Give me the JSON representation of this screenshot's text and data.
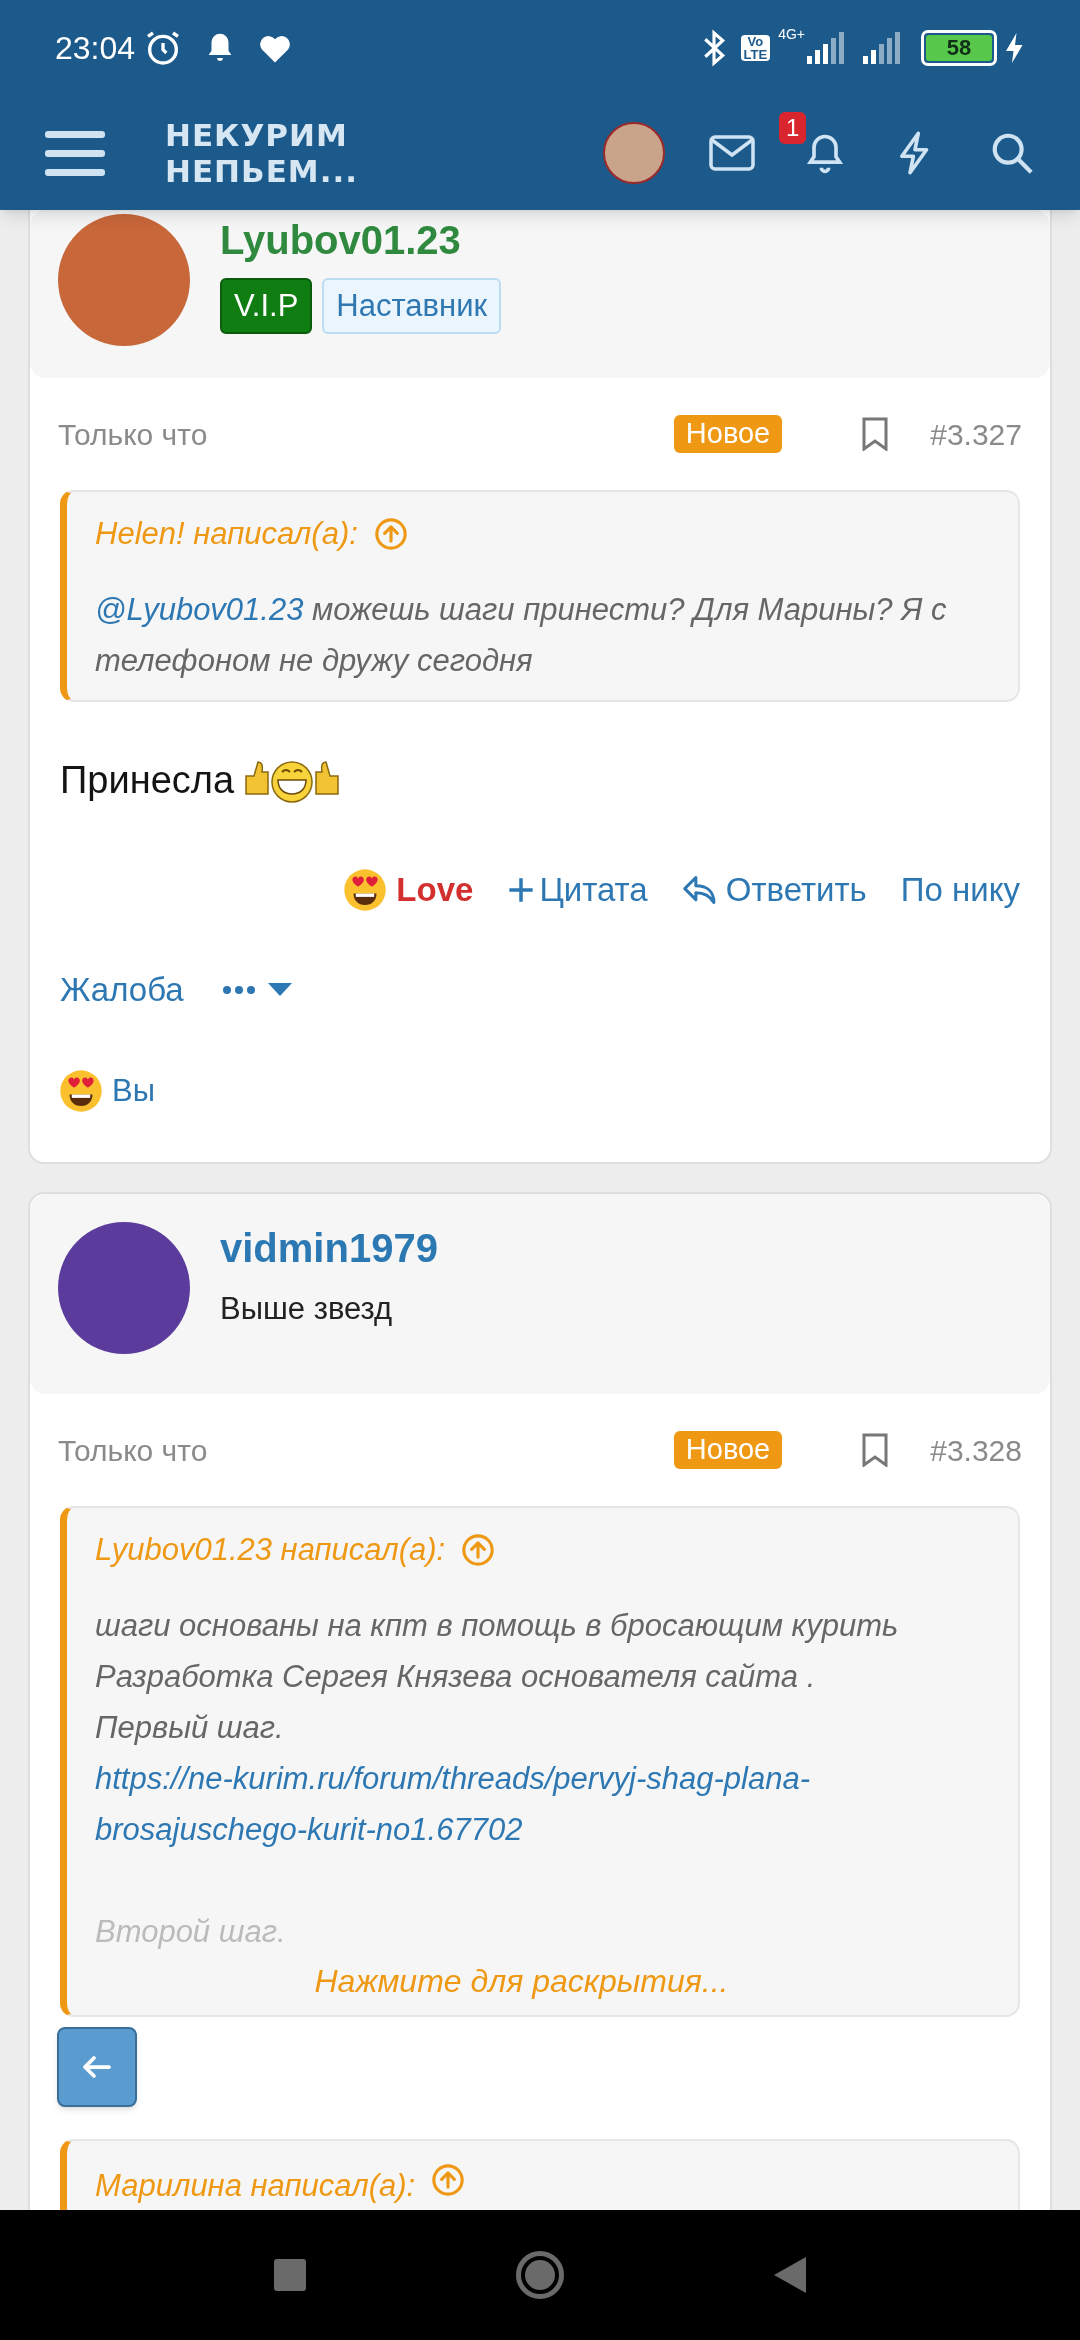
{
  "status_bar": {
    "time": "23:04",
    "volte": [
      "Vo",
      "LTE"
    ],
    "network": "4G+",
    "battery": "58"
  },
  "header": {
    "logo": [
      "НЕКУРИМ",
      "НЕПЬЕМ..."
    ],
    "notification_count": "1"
  },
  "posts": [
    {
      "author": "Lyubov01.23",
      "color": "#2f8a3f",
      "badges": [
        {
          "label": "V.I.P",
          "kind": "vip"
        },
        {
          "label": "Наставник",
          "kind": "mentor"
        }
      ],
      "time": "Только что",
      "new_label": "Новое",
      "number": "#3.327",
      "quote": {
        "author_line": "Helen! написал(а):",
        "paragraphs": [
          {
            "kind": "mention",
            "mention": "@Lyubov01.23",
            "text": " можешь шаги принести? Для Марины? Я с телефоном не дружу сегодня"
          }
        ]
      },
      "body": "Принесла",
      "actions": [
        {
          "kind": "reaction",
          "label": "Love"
        },
        {
          "kind": "quote",
          "label": "Цитата"
        },
        {
          "kind": "reply",
          "label": "Ответить"
        },
        {
          "kind": "plain",
          "label": "По нику"
        }
      ],
      "actions_extra": [
        {
          "kind": "plain",
          "label": "Жалоба"
        },
        {
          "kind": "more"
        }
      ],
      "reaction_summary": "Вы"
    },
    {
      "author": "vidmin1979",
      "color": "#2b78b3",
      "user_title": "Выше звезд",
      "time": "Только что",
      "new_label": "Новое",
      "number": "#3.328",
      "quote": {
        "author_line": "Lyubov01.23 написал(а):",
        "paragraphs": [
          {
            "kind": "text",
            "text": "шаги основаны на кпт в помощь в бросающим курить Разработка Сергея Князева основателя сайта ."
          },
          {
            "kind": "text",
            "text": "Первый шаг."
          },
          {
            "kind": "link",
            "text": "https://ne-kurim.ru/forum/threads/pervyj-shag-plana-brosajuschego-kurit-no1.67702"
          },
          {
            "kind": "gap"
          },
          {
            "kind": "faded",
            "text": "Второй шаг."
          }
        ],
        "expand": "Нажмите для раскрытия..."
      },
      "next_quote": "Марилина написал(а):"
    }
  ]
}
